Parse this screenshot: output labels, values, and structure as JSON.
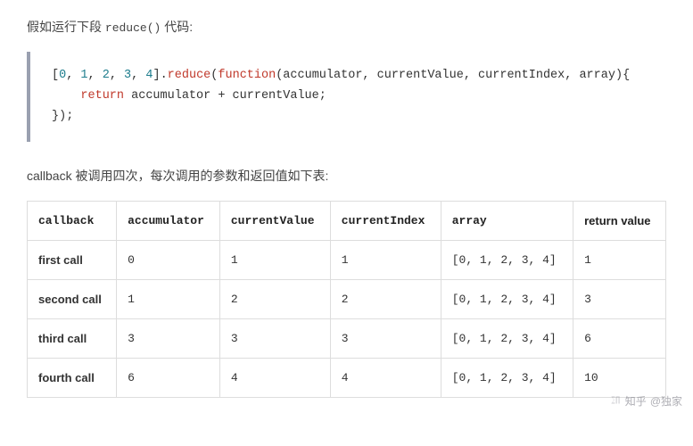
{
  "intro": {
    "prefix": "假如运行下段 ",
    "code_word": "reduce()",
    "suffix": " 代码:"
  },
  "code": {
    "line1_a": "[",
    "line1_nums": [
      "0",
      "1",
      "2",
      "3",
      "4"
    ],
    "line1_b": "].",
    "line1_method": "reduce",
    "line1_c": "(",
    "line1_kw": "function",
    "line1_d": "(accumulator, currentValue, currentIndex, array){",
    "line2_indent": "    ",
    "line2_kw": "return",
    "line2_rest": " accumulator + currentValue;",
    "line3": "});"
  },
  "middle_text": "callback 被调用四次，每次调用的参数和返回值如下表:",
  "table": {
    "headers": [
      "callback",
      "accumulator",
      "currentValue",
      "currentIndex",
      "array",
      "return value"
    ],
    "rows": [
      {
        "label": "first call",
        "accumulator": "0",
        "currentValue": "1",
        "currentIndex": "1",
        "array": "[0, 1, 2, 3, 4]",
        "return": "1"
      },
      {
        "label": "second call",
        "accumulator": "1",
        "currentValue": "2",
        "currentIndex": "2",
        "array": "[0, 1, 2, 3, 4]",
        "return": "3"
      },
      {
        "label": "third call",
        "accumulator": "3",
        "currentValue": "3",
        "currentIndex": "3",
        "array": "[0, 1, 2, 3, 4]",
        "return": "6"
      },
      {
        "label": "fourth call",
        "accumulator": "6",
        "currentValue": "4",
        "currentIndex": "4",
        "array": "[0, 1, 2, 3, 4]",
        "return": "10"
      }
    ]
  },
  "watermark": {
    "brand": "知乎",
    "user": "@独家"
  }
}
